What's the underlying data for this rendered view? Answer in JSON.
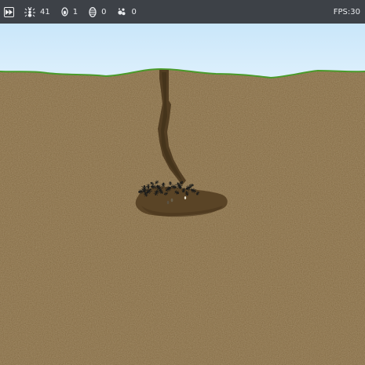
{
  "hud": {
    "fast_forward_icon": "fast-forward-icon",
    "ants": {
      "icon": "ant-icon",
      "value": "41"
    },
    "eggs": {
      "icon": "egg-icon",
      "value": "1"
    },
    "larvae": {
      "icon": "larva-icon",
      "value": "0"
    },
    "food": {
      "icon": "food-icon",
      "value": "0"
    },
    "fps_label": "FPS:",
    "fps_value": "30"
  },
  "colors": {
    "hud_bg": "#3d4147",
    "sky_top": "#c9e6fa",
    "sky_bottom": "#dff1fc",
    "soil": "#7a6038",
    "grass": "#4a9a2a",
    "tunnel": "#4e3a20",
    "chamber": "#5a4426",
    "ant": "#1c1c1a"
  }
}
